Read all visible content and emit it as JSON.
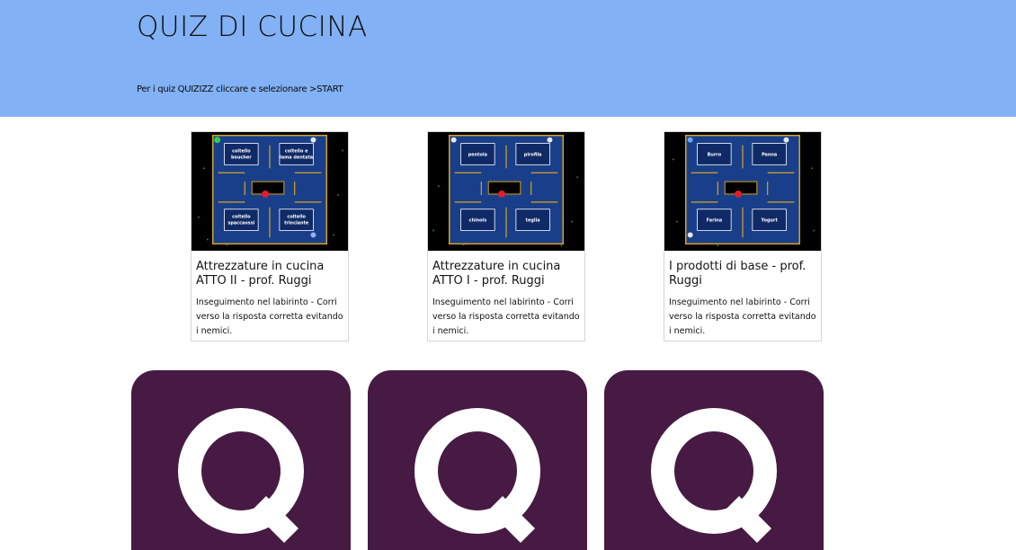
{
  "page": {
    "title": "QUIZ DI CUCINA",
    "subtitle": "Per i quiz QUIZIZZ cliccare e selezionare >START"
  },
  "cards": [
    {
      "title": "Attrezzature in cucina ATTO II - prof. Ruggi",
      "description": "Inseguimento nel labirinto - Corri verso la risposta corretta evitando i nemici.",
      "maze_labels": [
        "coltello boucher",
        "coltello e lama dentata",
        "coltello spaccaossi",
        "coltello trinciante"
      ],
      "icon": "pacman-maze-thumbnail"
    },
    {
      "title": "Attrezzature in cucina ATTO I - prof. Ruggi",
      "description": "Inseguimento nel labirinto - Corri verso la risposta corretta evitando i nemici.",
      "maze_labels": [
        "pentola",
        "pirofila",
        "chinois",
        "teglia"
      ],
      "icon": "pacman-maze-thumbnail"
    },
    {
      "title": "I prodotti di base - prof. Ruggi",
      "description": "Inseguimento nel labirinto - Corri verso la risposta corretta evitando i nemici.",
      "maze_labels": [
        "Burro",
        "Panna",
        "Farina",
        "Yogurt"
      ],
      "icon": "pacman-maze-thumbnail"
    }
  ],
  "logos": [
    {
      "icon": "quizizz-logo-icon"
    },
    {
      "icon": "quizizz-logo-icon"
    },
    {
      "icon": "quizizz-logo-icon"
    }
  ],
  "colors": {
    "header_bg": "#82b1f5",
    "maze_wall": "#1a3f8a",
    "maze_border": "#d8a420",
    "logo_bg": "#461a42"
  }
}
